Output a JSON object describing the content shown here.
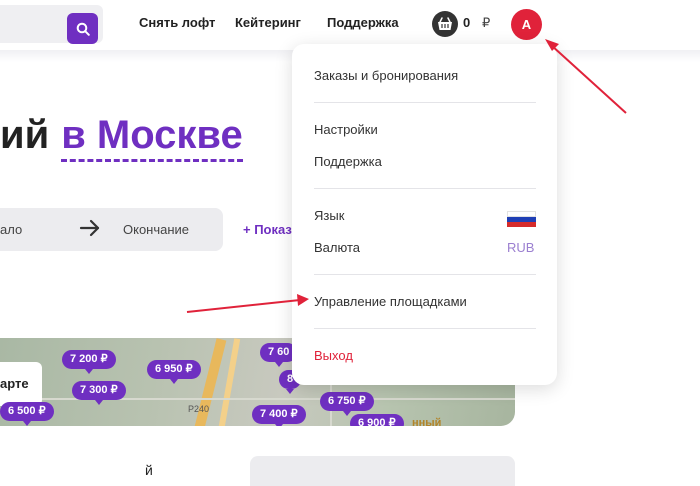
{
  "header": {
    "nav": [
      "Снять лофт",
      "Кейтеринг",
      "Поддержка"
    ],
    "cart_count": "0",
    "cart_currency": "₽",
    "avatar_initial": "A"
  },
  "hero": {
    "title_prefix": "ий",
    "title_accent": "в Москве"
  },
  "dates": {
    "start": "ало",
    "end": "Окончание"
  },
  "show_more": "+ Показ",
  "map": {
    "card_label": "арте",
    "pins": [
      "7 200 ₽",
      "7 60",
      "6 950 ₽",
      "8",
      "7 300 ₽",
      "6 500 ₽",
      "6 750 ₽",
      "7 400 ₽",
      "6 900 ₽"
    ],
    "road_label": "P240",
    "park_label": "нный"
  },
  "dropdown": {
    "orders": "Заказы и бронирования",
    "settings": "Настройки",
    "support": "Поддержка",
    "language": "Язык",
    "currency": "Валюта",
    "currency_value": "RUB",
    "manage_venues": "Управление площадками",
    "logout": "Выход"
  },
  "colors": {
    "accent": "#6f2fc1",
    "avatar": "#e0223a",
    "logout": "#e0223a",
    "annotation_arrow": "#e0223a"
  },
  "bottom": {
    "left_text": "й"
  }
}
